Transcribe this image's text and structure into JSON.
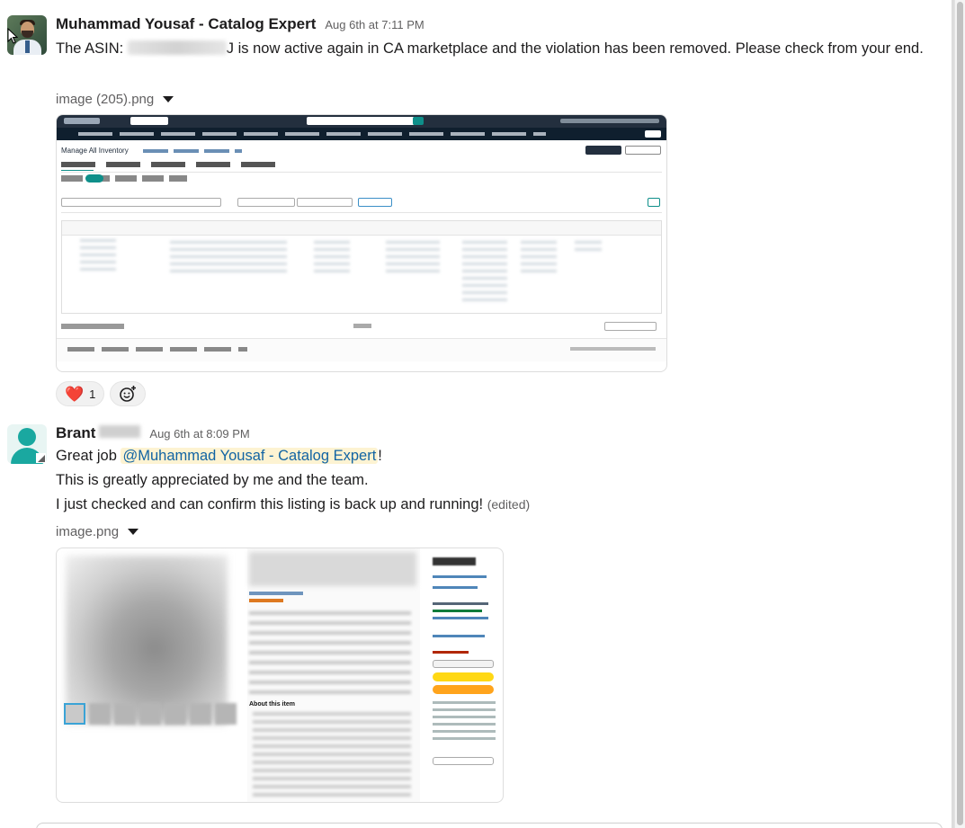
{
  "messages": [
    {
      "author": "Muhammad Yousaf - Catalog Expert",
      "timestamp": "Aug 6th at 7:11 PM",
      "text_before": "The ASIN: ",
      "text_after": "J is now active again in CA marketplace and the violation has been removed. Please check from your end.",
      "file_name": "image (205).png",
      "reactions": [
        {
          "icon": "red-heart",
          "emoji": "❤️",
          "count": "1"
        },
        {
          "icon": "add-reaction-icon"
        }
      ],
      "attachment": {
        "title": "Manage All Inventory"
      }
    },
    {
      "author": "Brant",
      "timestamp": "Aug 6th at 8:09 PM",
      "line1_before": "Great job ",
      "mention": "@Muhammad Yousaf - Catalog Expert",
      "line1_after": "!",
      "line2": "This is greatly appreciated by me and the team.",
      "line3": "I just checked and can confirm this listing is back up and running!",
      "edited": "(edited)",
      "file_name": "image.png",
      "attachment": {
        "about": "About this item"
      }
    }
  ],
  "colors": {
    "mention_bg": "#fdf3d2",
    "mention_text": "#1264a3",
    "seller_central_bar": "#232f3e",
    "add_to_cart": "#ffd814",
    "buy_now": "#ffa41c"
  }
}
